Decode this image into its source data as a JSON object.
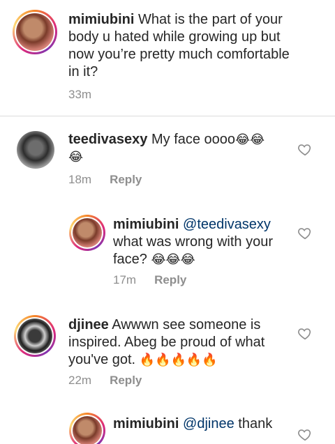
{
  "caption": {
    "username": "mimiubini",
    "text": "What is the part of your body u hated while growing up but now you’re pretty much comfortable in it?",
    "time": "33m"
  },
  "reply_label": "Reply",
  "comments": [
    {
      "username": "teedivasexy",
      "text": "My face oooo",
      "emoji": "😂😂😂",
      "time": "18m"
    },
    {
      "username": "mimiubini",
      "mention": "@teedivasexy",
      "text": "what was wrong with your face?",
      "emoji": "😂😂😂",
      "time": "17m"
    },
    {
      "username": "djinee",
      "text": "Awwwn see someone is inspired. Abeg be proud of what you've got.",
      "emoji": "🔥🔥🔥🔥🔥",
      "time": "22m"
    },
    {
      "username": "mimiubini",
      "mention": "@djinee",
      "text": "thank"
    }
  ],
  "colors": {
    "mention": "#003569",
    "meta": "#8e8e8e",
    "divider": "#dbdbdb"
  }
}
